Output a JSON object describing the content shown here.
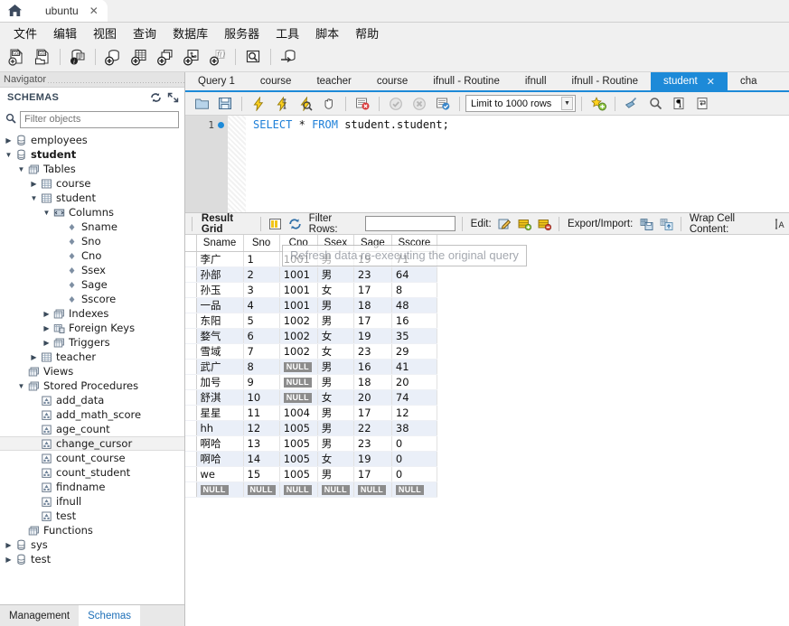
{
  "window": {
    "home_icon": "home-icon",
    "tab_label": "ubuntu",
    "tab_close": "✕"
  },
  "menu": {
    "items": [
      "文件",
      "编辑",
      "视图",
      "查询",
      "数据库",
      "服务器",
      "工具",
      "脚本",
      "帮助"
    ]
  },
  "main_toolbar": {
    "buttons": [
      {
        "name": "new-sql-tab-icon",
        "title": "新建 SQL 标签"
      },
      {
        "name": "open-sql-script-icon",
        "title": "打开 SQL 脚本"
      },
      {
        "name": "inspector-icon",
        "title": "检查器"
      },
      {
        "name": "create-schema-icon",
        "title": "创建架构"
      },
      {
        "name": "create-table-icon",
        "title": "创建表"
      },
      {
        "name": "create-view-icon",
        "title": "创建视图"
      },
      {
        "name": "create-procedure-icon",
        "title": "创建存储过程"
      },
      {
        "name": "create-function-icon",
        "title": "创建函数"
      },
      {
        "name": "search-data-icon",
        "title": "搜索数据"
      },
      {
        "name": "reconnect-server-icon",
        "title": "重新连接服务器"
      }
    ]
  },
  "navigator": {
    "title": "Navigator",
    "schemas_label": "SCHEMAS",
    "refresh_icon": "refresh-icon",
    "collapse_icon": "collapse-all-icon",
    "filter_placeholder": "Filter objects",
    "search_icon": "search-icon",
    "tree": [
      {
        "label": "employees",
        "indent": 0,
        "arrow": "right",
        "icon": "schema-icon",
        "bold": false,
        "highlight": false
      },
      {
        "label": "student",
        "indent": 0,
        "arrow": "down",
        "icon": "schema-icon",
        "bold": true,
        "highlight": false
      },
      {
        "label": "Tables",
        "indent": 1,
        "arrow": "down",
        "icon": "folder-tables-icon",
        "bold": false,
        "highlight": false
      },
      {
        "label": "course",
        "indent": 2,
        "arrow": "right",
        "icon": "table-icon",
        "bold": false,
        "highlight": false
      },
      {
        "label": "student",
        "indent": 2,
        "arrow": "down",
        "icon": "table-icon",
        "bold": false,
        "highlight": false
      },
      {
        "label": "Columns",
        "indent": 3,
        "arrow": "down",
        "icon": "columns-icon",
        "bold": false,
        "highlight": false
      },
      {
        "label": "Sname",
        "indent": 4,
        "arrow": "none",
        "icon": "column-icon",
        "bold": false,
        "highlight": false
      },
      {
        "label": "Sno",
        "indent": 4,
        "arrow": "none",
        "icon": "column-icon",
        "bold": false,
        "highlight": false
      },
      {
        "label": "Cno",
        "indent": 4,
        "arrow": "none",
        "icon": "column-icon",
        "bold": false,
        "highlight": false
      },
      {
        "label": "Ssex",
        "indent": 4,
        "arrow": "none",
        "icon": "column-icon",
        "bold": false,
        "highlight": false
      },
      {
        "label": "Sage",
        "indent": 4,
        "arrow": "none",
        "icon": "column-icon",
        "bold": false,
        "highlight": false
      },
      {
        "label": "Sscore",
        "indent": 4,
        "arrow": "none",
        "icon": "column-icon",
        "bold": false,
        "highlight": false
      },
      {
        "label": "Indexes",
        "indent": 3,
        "arrow": "right",
        "icon": "folder-tables-icon",
        "bold": false,
        "highlight": false
      },
      {
        "label": "Foreign Keys",
        "indent": 3,
        "arrow": "right",
        "icon": "folder-fk-icon",
        "bold": false,
        "highlight": false
      },
      {
        "label": "Triggers",
        "indent": 3,
        "arrow": "right",
        "icon": "folder-tables-icon",
        "bold": false,
        "highlight": false
      },
      {
        "label": "teacher",
        "indent": 2,
        "arrow": "right",
        "icon": "table-icon",
        "bold": false,
        "highlight": false
      },
      {
        "label": "Views",
        "indent": 1,
        "arrow": "none",
        "icon": "folder-tables-icon",
        "bold": false,
        "highlight": false
      },
      {
        "label": "Stored Procedures",
        "indent": 1,
        "arrow": "down",
        "icon": "folder-tables-icon",
        "bold": false,
        "highlight": false
      },
      {
        "label": "add_data",
        "indent": 2,
        "arrow": "none",
        "icon": "routine-icon",
        "bold": false,
        "highlight": false
      },
      {
        "label": "add_math_score",
        "indent": 2,
        "arrow": "none",
        "icon": "routine-icon",
        "bold": false,
        "highlight": false
      },
      {
        "label": "age_count",
        "indent": 2,
        "arrow": "none",
        "icon": "routine-icon",
        "bold": false,
        "highlight": false
      },
      {
        "label": "change_cursor",
        "indent": 2,
        "arrow": "none",
        "icon": "routine-icon",
        "bold": false,
        "highlight": true
      },
      {
        "label": "count_course",
        "indent": 2,
        "arrow": "none",
        "icon": "routine-icon",
        "bold": false,
        "highlight": false
      },
      {
        "label": "count_student",
        "indent": 2,
        "arrow": "none",
        "icon": "routine-icon",
        "bold": false,
        "highlight": false
      },
      {
        "label": "findname",
        "indent": 2,
        "arrow": "none",
        "icon": "routine-icon",
        "bold": false,
        "highlight": false
      },
      {
        "label": "ifnull",
        "indent": 2,
        "arrow": "none",
        "icon": "routine-icon",
        "bold": false,
        "highlight": false
      },
      {
        "label": "test",
        "indent": 2,
        "arrow": "none",
        "icon": "routine-icon",
        "bold": false,
        "highlight": false
      },
      {
        "label": "Functions",
        "indent": 1,
        "arrow": "none",
        "icon": "folder-tables-icon",
        "bold": false,
        "highlight": false
      },
      {
        "label": "sys",
        "indent": 0,
        "arrow": "right",
        "icon": "schema-icon",
        "bold": false,
        "highlight": false
      },
      {
        "label": "test",
        "indent": 0,
        "arrow": "right",
        "icon": "schema-icon",
        "bold": false,
        "highlight": false
      }
    ],
    "bottom_tabs": [
      {
        "label": "Management",
        "active": false
      },
      {
        "label": "Schemas",
        "active": true
      }
    ]
  },
  "editor_tabs": [
    {
      "label": "Query 1",
      "active": false,
      "closable": false
    },
    {
      "label": "course",
      "active": false,
      "closable": false
    },
    {
      "label": "teacher",
      "active": false,
      "closable": false
    },
    {
      "label": "course",
      "active": false,
      "closable": false
    },
    {
      "label": "ifnull - Routine",
      "active": false,
      "closable": false
    },
    {
      "label": "ifnull",
      "active": false,
      "closable": false
    },
    {
      "label": "ifnull - Routine",
      "active": false,
      "closable": false
    },
    {
      "label": "student",
      "active": true,
      "closable": true,
      "close": "✕"
    },
    {
      "label": "cha",
      "active": false,
      "closable": false
    }
  ],
  "query_toolbar": {
    "buttons": [
      {
        "name": "open-script-icon"
      },
      {
        "name": "save-script-icon"
      },
      {
        "name": "execute-statement-icon"
      },
      {
        "name": "execute-current-statement-icon"
      },
      {
        "name": "explain-plan-icon"
      },
      {
        "name": "stop-script-icon"
      },
      {
        "name": "toggle-stop-on-error-icon"
      },
      {
        "name": "commit-icon"
      },
      {
        "name": "rollback-icon"
      },
      {
        "name": "autocommit-icon"
      },
      {
        "name": "beautify-sql-icon"
      },
      {
        "name": "find-icon"
      },
      {
        "name": "toggle-invisible-chars-icon"
      },
      {
        "name": "wrap-lines-icon"
      }
    ],
    "limit_label": "Limit to 1000 rows",
    "limit_caret": "▼"
  },
  "sql": {
    "line_number": "1",
    "keyword1": "SELECT",
    "star": "*",
    "keyword2": "FROM",
    "target": "student.student;"
  },
  "grid_toolbar": {
    "result_grid_label": "Result Grid",
    "form_editor_icon": "form-editor-icon",
    "refresh_icon": "refresh-grid-icon",
    "filter_rows_label": "Filter Rows:",
    "filter_rows_value": "",
    "edit_label": "Edit:",
    "edit_icon": "edit-cell-icon",
    "insert_row_icon": "insert-row-icon",
    "delete_row_icon": "delete-row-icon",
    "export_import_label": "Export/Import:",
    "export_icon": "export-recordset-icon",
    "import_icon": "import-recordset-icon",
    "wrap_cell_label": "Wrap Cell Content:",
    "wrap_cell_icon": "wrap-cell-icon"
  },
  "tooltip": {
    "text": "Refresh data re-executing the original query"
  },
  "result": {
    "columns": [
      "Sname",
      "Sno",
      "Cno",
      "Ssex",
      "Sage",
      "Sscore"
    ],
    "rows": [
      [
        "李广",
        "1",
        "1001",
        "男",
        "19",
        "71"
      ],
      [
        "孙部",
        "2",
        "1001",
        "男",
        "23",
        "64"
      ],
      [
        "孙玉",
        "3",
        "1001",
        "女",
        "17",
        "8"
      ],
      [
        "一品",
        "4",
        "1001",
        "男",
        "18",
        "48"
      ],
      [
        "东阳",
        "5",
        "1002",
        "男",
        "17",
        "16"
      ],
      [
        "婺气",
        "6",
        "1002",
        "女",
        "19",
        "35"
      ],
      [
        "雪域",
        "7",
        "1002",
        "女",
        "23",
        "29"
      ],
      [
        "武广",
        "8",
        "NULL",
        "男",
        "16",
        "41"
      ],
      [
        "加号",
        "9",
        "NULL",
        "男",
        "18",
        "20"
      ],
      [
        "舒淇",
        "10",
        "NULL",
        "女",
        "20",
        "74"
      ],
      [
        "星星",
        "11",
        "1004",
        "男",
        "17",
        "12"
      ],
      [
        "hh",
        "12",
        "1005",
        "男",
        "22",
        "38"
      ],
      [
        "啊哈",
        "13",
        "1005",
        "男",
        "23",
        "0"
      ],
      [
        "啊哈",
        "14",
        "1005",
        "女",
        "19",
        "0"
      ],
      [
        "we",
        "15",
        "1005",
        "男",
        "17",
        "0"
      ],
      [
        "NULL",
        "NULL",
        "NULL",
        "NULL",
        "NULL",
        "NULL"
      ]
    ],
    "null_token": "NULL"
  },
  "colors": {
    "accent": "#1d8ad8",
    "chrome": "#f0f0f0",
    "grid_alt_row": "#eaeff8",
    "null_badge": "#8c8c8c",
    "keyword": "#1d7fd8"
  }
}
